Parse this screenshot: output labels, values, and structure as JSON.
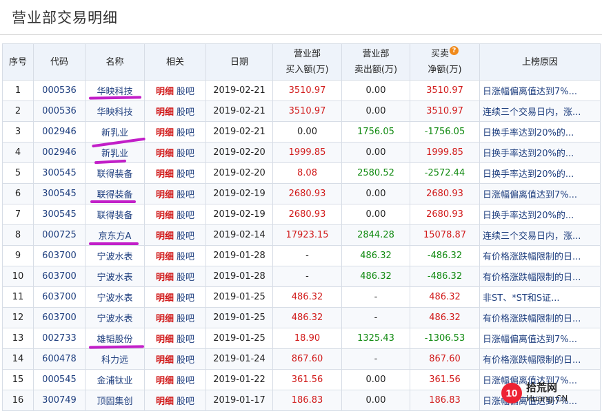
{
  "page": {
    "title": "营业部交易明细"
  },
  "table": {
    "headers": {
      "idx": "序号",
      "code": "代码",
      "name": "名称",
      "related": "相关",
      "date": "日期",
      "buy_line1": "营业部",
      "buy_line2": "买入额(万)",
      "sell_line1": "营业部",
      "sell_line2": "卖出额(万)",
      "net_line1": "买卖",
      "net_line2": "净额(万)",
      "reason": "上榜原因"
    },
    "related_detail_label": "明细",
    "related_forum_label": "股吧",
    "rows": [
      {
        "idx": "1",
        "code": "000536",
        "name": "华映科技",
        "date": "2019-02-21",
        "buy": "3510.97",
        "sell": "0.00",
        "net": "3510.97",
        "reason": "日涨幅偏离值达到7%..."
      },
      {
        "idx": "2",
        "code": "000536",
        "name": "华映科技",
        "date": "2019-02-21",
        "buy": "3510.97",
        "sell": "0.00",
        "net": "3510.97",
        "reason": "连续三个交易日内，涨..."
      },
      {
        "idx": "3",
        "code": "002946",
        "name": "新乳业",
        "date": "2019-02-21",
        "buy": "0.00",
        "sell": "1756.05",
        "net": "-1756.05",
        "reason": "日换手率达到20%的..."
      },
      {
        "idx": "4",
        "code": "002946",
        "name": "新乳业",
        "date": "2019-02-20",
        "buy": "1999.85",
        "sell": "0.00",
        "net": "1999.85",
        "reason": "日换手率达到20%的..."
      },
      {
        "idx": "5",
        "code": "300545",
        "name": "联得装备",
        "date": "2019-02-20",
        "buy": "8.08",
        "sell": "2580.52",
        "net": "-2572.44",
        "reason": "日换手率达到20%的..."
      },
      {
        "idx": "6",
        "code": "300545",
        "name": "联得装备",
        "date": "2019-02-19",
        "buy": "2680.93",
        "sell": "0.00",
        "net": "2680.93",
        "reason": "日涨幅偏离值达到7%..."
      },
      {
        "idx": "7",
        "code": "300545",
        "name": "联得装备",
        "date": "2019-02-19",
        "buy": "2680.93",
        "sell": "0.00",
        "net": "2680.93",
        "reason": "日换手率达到20%的..."
      },
      {
        "idx": "8",
        "code": "000725",
        "name": "京东方A",
        "date": "2019-02-14",
        "buy": "17923.15",
        "sell": "2844.28",
        "net": "15078.87",
        "reason": "连续三个交易日内，涨..."
      },
      {
        "idx": "9",
        "code": "603700",
        "name": "宁波水表",
        "date": "2019-01-28",
        "buy": "-",
        "sell": "486.32",
        "net": "-486.32",
        "reason": "有价格涨跌幅限制的日..."
      },
      {
        "idx": "10",
        "code": "603700",
        "name": "宁波水表",
        "date": "2019-01-28",
        "buy": "-",
        "sell": "486.32",
        "net": "-486.32",
        "reason": "有价格涨跌幅限制的日..."
      },
      {
        "idx": "11",
        "code": "603700",
        "name": "宁波水表",
        "date": "2019-01-25",
        "buy": "486.32",
        "sell": "-",
        "net": "486.32",
        "reason": "非ST、*ST和S证..."
      },
      {
        "idx": "12",
        "code": "603700",
        "name": "宁波水表",
        "date": "2019-01-25",
        "buy": "486.32",
        "sell": "-",
        "net": "486.32",
        "reason": "有价格涨跌幅限制的日..."
      },
      {
        "idx": "13",
        "code": "002733",
        "name": "雄韬股份",
        "date": "2019-01-25",
        "buy": "18.90",
        "sell": "1325.43",
        "net": "-1306.53",
        "reason": "日涨幅偏离值达到7%..."
      },
      {
        "idx": "14",
        "code": "600478",
        "name": "科力远",
        "date": "2019-01-24",
        "buy": "867.60",
        "sell": "-",
        "net": "867.60",
        "reason": "有价格涨跌幅限制的日..."
      },
      {
        "idx": "15",
        "code": "000545",
        "name": "金浦钛业",
        "date": "2019-01-22",
        "buy": "361.56",
        "sell": "0.00",
        "net": "361.56",
        "reason": "日涨幅偏离值达到7%..."
      },
      {
        "idx": "16",
        "code": "300749",
        "name": "顶固集创",
        "date": "2019-01-17",
        "buy": "186.83",
        "sell": "0.00",
        "net": "186.83",
        "reason": "日涨幅偏离值达到7%..."
      }
    ]
  },
  "watermark": {
    "logo": "10",
    "top": "拾荒网",
    "bottom": "Huang.CN"
  },
  "colors": {
    "positive": "#d11a1a",
    "negative": "#118a11",
    "link": "#1f3f7f",
    "annotation": "#c21fc8",
    "header_bg": "#eef3fa"
  },
  "icons": {
    "net_header_hint": "question-circle-icon"
  }
}
